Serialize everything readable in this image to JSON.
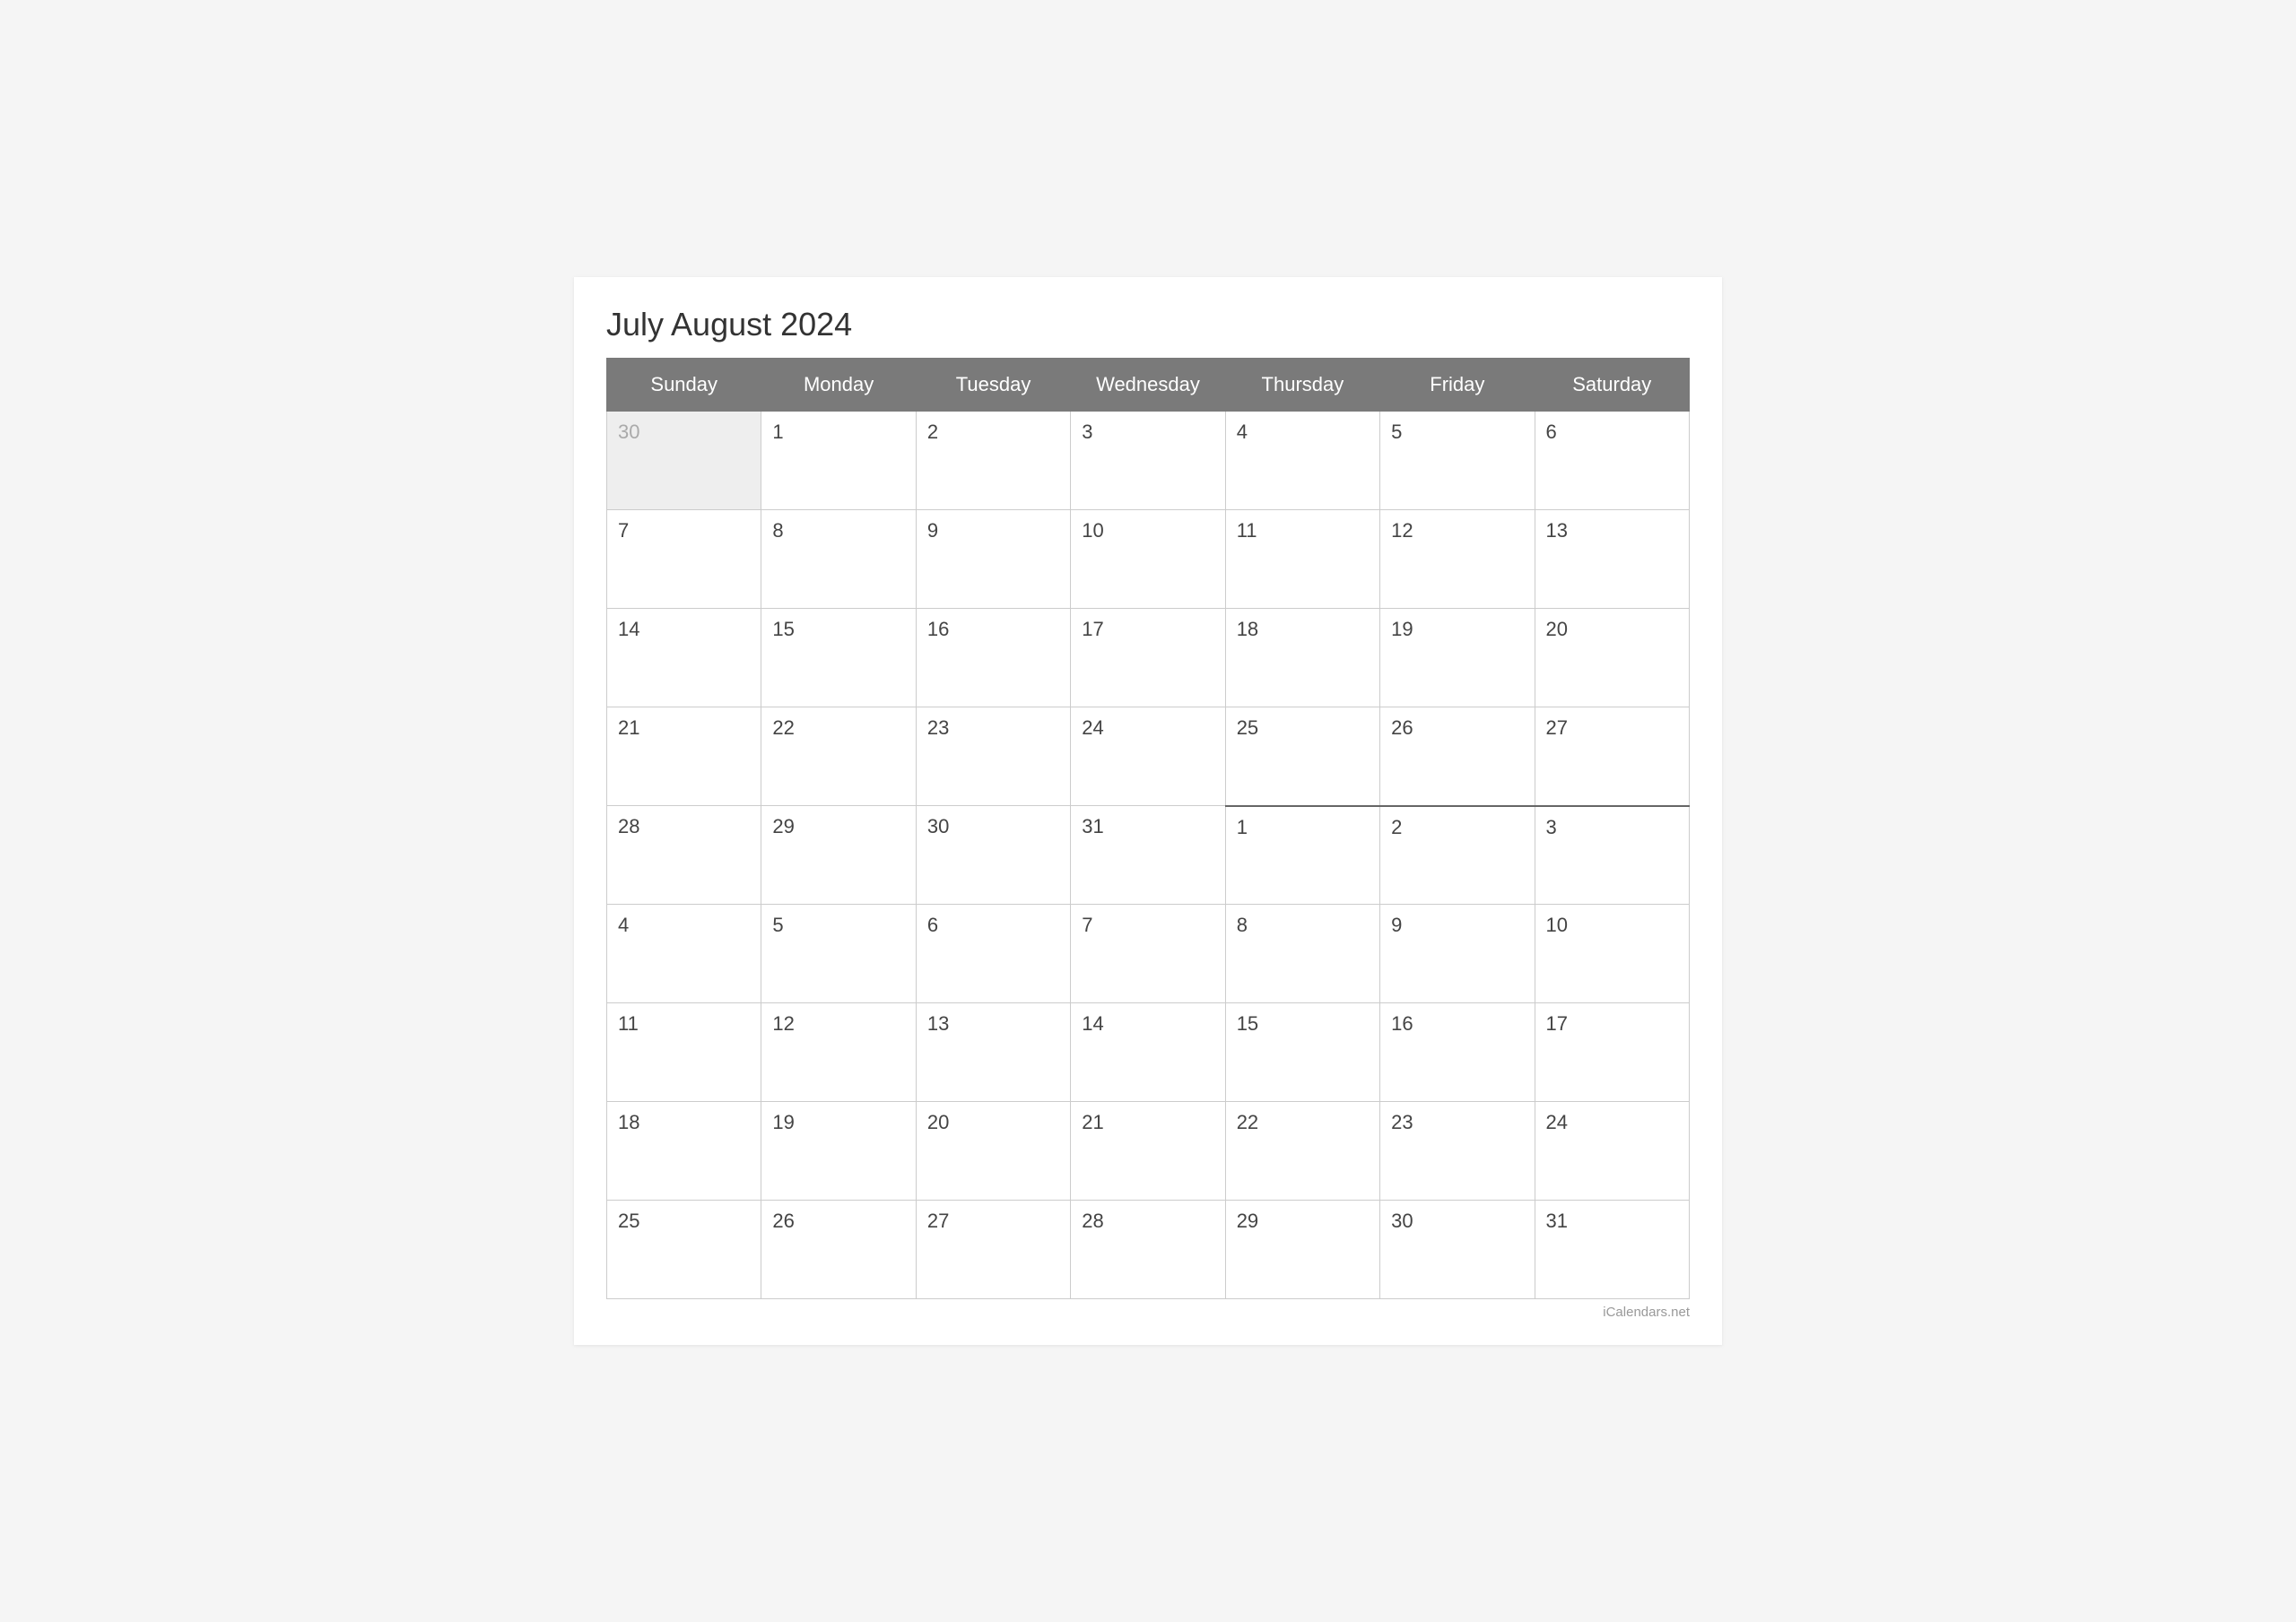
{
  "title": "July August 2024",
  "watermark": "iCalendars.net",
  "headers": [
    "Sunday",
    "Monday",
    "Tuesday",
    "Wednesday",
    "Thursday",
    "Friday",
    "Saturday"
  ],
  "weeks": [
    {
      "days": [
        {
          "num": "30",
          "type": "prev-month"
        },
        {
          "num": "1",
          "type": "current"
        },
        {
          "num": "2",
          "type": "current"
        },
        {
          "num": "3",
          "type": "current"
        },
        {
          "num": "4",
          "type": "current"
        },
        {
          "num": "5",
          "type": "current"
        },
        {
          "num": "6",
          "type": "current"
        }
      ]
    },
    {
      "days": [
        {
          "num": "7",
          "type": "current"
        },
        {
          "num": "8",
          "type": "current"
        },
        {
          "num": "9",
          "type": "current"
        },
        {
          "num": "10",
          "type": "current"
        },
        {
          "num": "11",
          "type": "current"
        },
        {
          "num": "12",
          "type": "current"
        },
        {
          "num": "13",
          "type": "current"
        }
      ]
    },
    {
      "days": [
        {
          "num": "14",
          "type": "current"
        },
        {
          "num": "15",
          "type": "current"
        },
        {
          "num": "16",
          "type": "current"
        },
        {
          "num": "17",
          "type": "current"
        },
        {
          "num": "18",
          "type": "current"
        },
        {
          "num": "19",
          "type": "current"
        },
        {
          "num": "20",
          "type": "current"
        }
      ]
    },
    {
      "days": [
        {
          "num": "21",
          "type": "current"
        },
        {
          "num": "22",
          "type": "current"
        },
        {
          "num": "23",
          "type": "current"
        },
        {
          "num": "24",
          "type": "current"
        },
        {
          "num": "25",
          "type": "current"
        },
        {
          "num": "26",
          "type": "current"
        },
        {
          "num": "27",
          "type": "current"
        }
      ]
    },
    {
      "days": [
        {
          "num": "28",
          "type": "current"
        },
        {
          "num": "29",
          "type": "current"
        },
        {
          "num": "30",
          "type": "current"
        },
        {
          "num": "31",
          "type": "current"
        },
        {
          "num": "1",
          "type": "next-month month-divider-left"
        },
        {
          "num": "2",
          "type": "next-month month-divider-left"
        },
        {
          "num": "3",
          "type": "next-month month-divider-left"
        }
      ]
    },
    {
      "days": [
        {
          "num": "4",
          "type": "next-month"
        },
        {
          "num": "5",
          "type": "next-month"
        },
        {
          "num": "6",
          "type": "next-month"
        },
        {
          "num": "7",
          "type": "next-month"
        },
        {
          "num": "8",
          "type": "next-month"
        },
        {
          "num": "9",
          "type": "next-month"
        },
        {
          "num": "10",
          "type": "next-month"
        }
      ]
    },
    {
      "days": [
        {
          "num": "11",
          "type": "next-month"
        },
        {
          "num": "12",
          "type": "next-month"
        },
        {
          "num": "13",
          "type": "next-month"
        },
        {
          "num": "14",
          "type": "next-month"
        },
        {
          "num": "15",
          "type": "next-month"
        },
        {
          "num": "16",
          "type": "next-month"
        },
        {
          "num": "17",
          "type": "next-month"
        }
      ]
    },
    {
      "days": [
        {
          "num": "18",
          "type": "next-month"
        },
        {
          "num": "19",
          "type": "next-month"
        },
        {
          "num": "20",
          "type": "next-month"
        },
        {
          "num": "21",
          "type": "next-month"
        },
        {
          "num": "22",
          "type": "next-month"
        },
        {
          "num": "23",
          "type": "next-month"
        },
        {
          "num": "24",
          "type": "next-month"
        }
      ]
    },
    {
      "days": [
        {
          "num": "25",
          "type": "next-month"
        },
        {
          "num": "26",
          "type": "next-month"
        },
        {
          "num": "27",
          "type": "next-month"
        },
        {
          "num": "28",
          "type": "next-month"
        },
        {
          "num": "29",
          "type": "next-month"
        },
        {
          "num": "30",
          "type": "next-month"
        },
        {
          "num": "31",
          "type": "next-month"
        }
      ]
    }
  ]
}
